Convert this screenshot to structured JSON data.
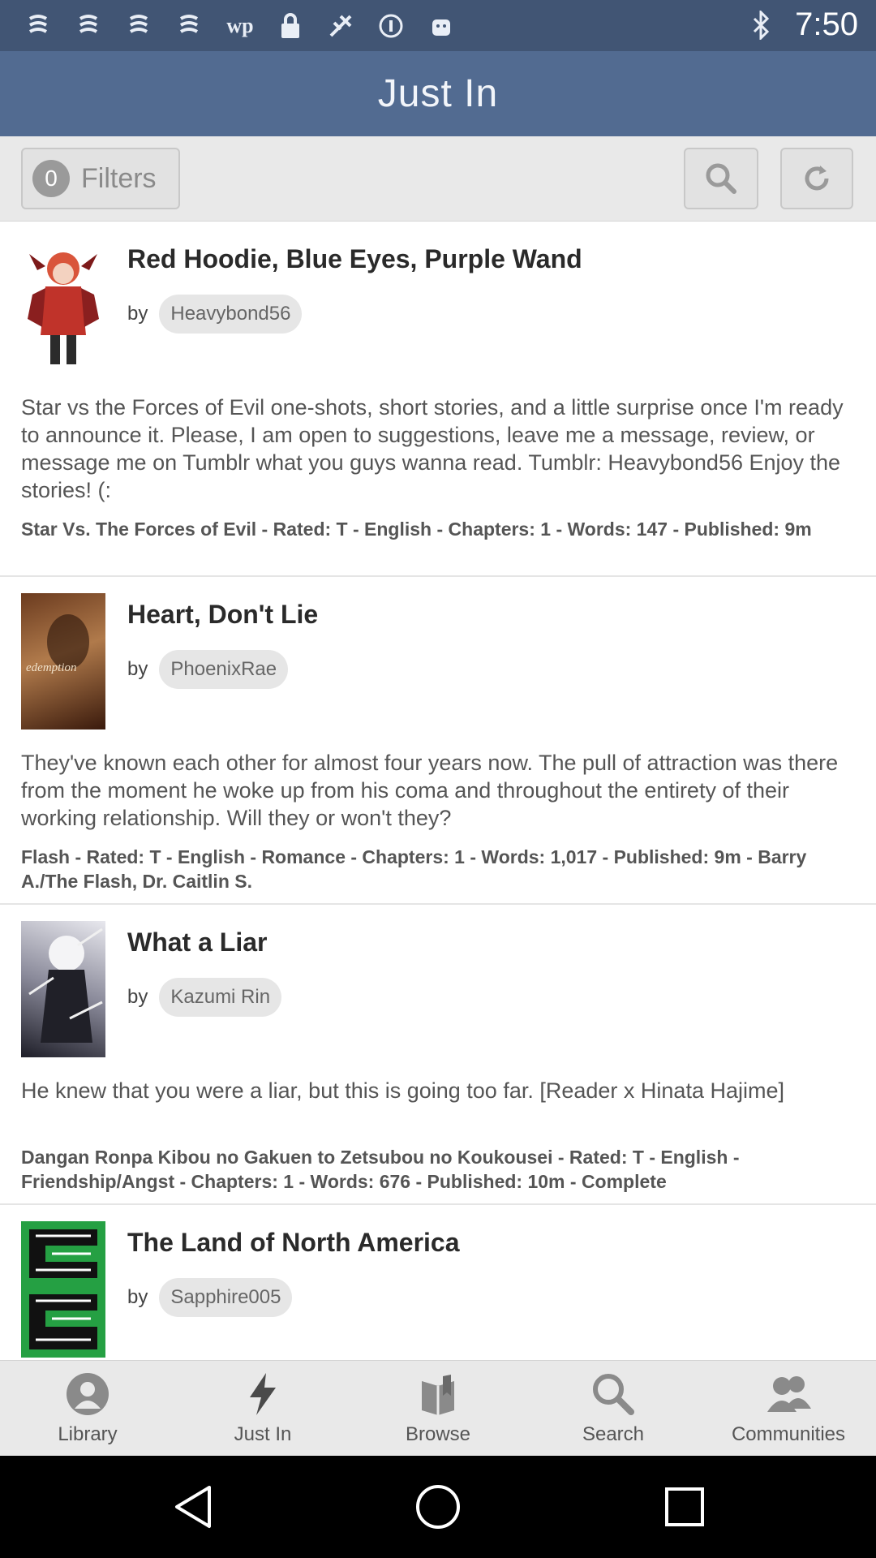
{
  "status_bar": {
    "time": "7:50",
    "icons_left": [
      "notification-icon",
      "notification-icon",
      "notification-icon",
      "notification-icon",
      "wp-icon",
      "lock-icon",
      "fake-gps-icon",
      "info-icon",
      "android-icon"
    ],
    "icons_right": [
      "bluetooth-icon"
    ]
  },
  "header": {
    "title": "Just In"
  },
  "toolbar": {
    "filter_count": "0",
    "filters_label": "Filters",
    "search_icon": "search-icon",
    "refresh_icon": "refresh-icon"
  },
  "stories": [
    {
      "title": "Red Hoodie, Blue Eyes, Purple Wand",
      "by": "by",
      "author": "Heavybond56",
      "summary": "Star vs the Forces of Evil one-shots, short stories, and a little surprise once I'm ready to announce it. Please, I am open to suggestions, leave me a message, review, or message me on Tumblr what you guys wanna read. Tumblr: Heavybond56 Enjoy the stories! (:",
      "meta": "Star Vs. The Forces of Evil - Rated: T - English - Chapters: 1 - Words: 147 - Published: 9m"
    },
    {
      "title": "Heart, Don't Lie",
      "by": "by",
      "author": "PhoenixRae",
      "summary": "They've known each other for almost four years now. The pull of attraction was there from the moment he woke up from his coma and throughout the entirety of their working relationship. Will they or won't they?",
      "meta": "Flash - Rated: T - English - Romance - Chapters: 1 - Words: 1,017 - Published: 9m - Barry A./The Flash, Dr. Caitlin S."
    },
    {
      "title": "What a Liar",
      "by": "by",
      "author": "Kazumi Rin",
      "summary": "He knew that you were a liar, but this is going too far. [Reader x Hinata Hajime]",
      "meta": "Dangan Ronpa Kibou no Gakuen to Zetsubou no Koukousei - Rated: T - English - Friendship/Angst - Chapters: 1 - Words: 676 - Published: 10m - Complete"
    },
    {
      "title": "The Land of North America",
      "by": "by",
      "author": "Sapphire005",
      "summary": "",
      "meta": ""
    }
  ],
  "bottom_nav": [
    {
      "label": "Library",
      "icon": "person-icon"
    },
    {
      "label": "Just In",
      "icon": "lightning-icon"
    },
    {
      "label": "Browse",
      "icon": "book-icon"
    },
    {
      "label": "Search",
      "icon": "search-icon"
    },
    {
      "label": "Communities",
      "icon": "group-icon"
    }
  ],
  "system_nav": [
    "back-icon",
    "home-icon",
    "recents-icon"
  ]
}
